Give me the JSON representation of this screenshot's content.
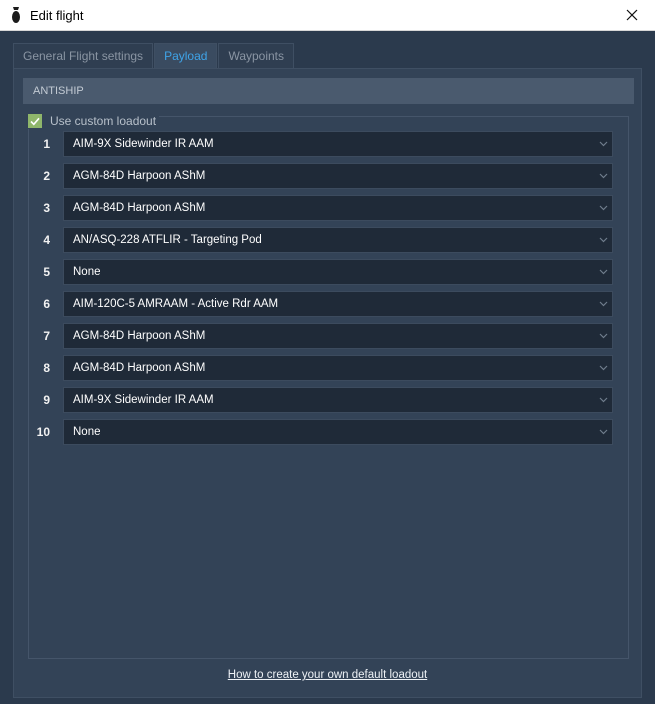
{
  "window": {
    "title": "Edit flight",
    "icon": "bomb-icon"
  },
  "tabs": [
    {
      "label": "General Flight settings",
      "active": false
    },
    {
      "label": "Payload",
      "active": true
    },
    {
      "label": "Waypoints",
      "active": false
    }
  ],
  "section": {
    "header": "ANTISHIP"
  },
  "custom_loadout": {
    "label": "Use custom loadout",
    "checked": true
  },
  "slots": [
    {
      "number": "1",
      "value": "AIM-9X Sidewinder IR AAM"
    },
    {
      "number": "2",
      "value": "AGM-84D Harpoon AShM"
    },
    {
      "number": "3",
      "value": "AGM-84D Harpoon AShM"
    },
    {
      "number": "4",
      "value": "AN/ASQ-228 ATFLIR - Targeting Pod"
    },
    {
      "number": "5",
      "value": "None"
    },
    {
      "number": "6",
      "value": "AIM-120C-5 AMRAAM - Active Rdr AAM"
    },
    {
      "number": "7",
      "value": "AGM-84D Harpoon AShM"
    },
    {
      "number": "8",
      "value": "AGM-84D Harpoon AShM"
    },
    {
      "number": "9",
      "value": "AIM-9X Sidewinder IR AAM"
    },
    {
      "number": "10",
      "value": "None"
    }
  ],
  "help_link": {
    "label": "How to create your own default loadout"
  },
  "colors": {
    "background": "#2b3a4d",
    "active_tab_text": "#3fa4e8",
    "checkbox": "#8fb66b",
    "dropdown": "#1f2a38"
  }
}
